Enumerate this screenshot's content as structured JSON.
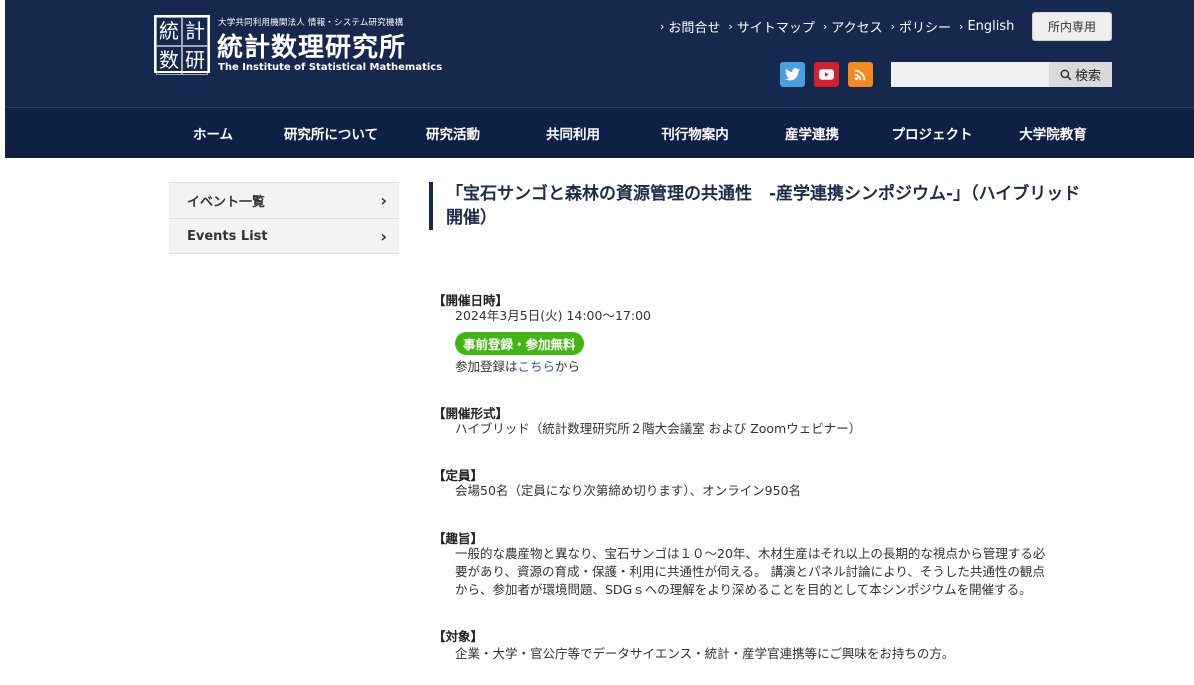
{
  "header": {
    "logo_mark": [
      "統",
      "計",
      "数",
      "研"
    ],
    "logo_sub": "大学共同利用機関法人 情報・システム研究機構",
    "logo_title": "統計数理研究所",
    "logo_en": "The Institute of Statistical Mathematics",
    "util_links": [
      {
        "label": "お問合せ"
      },
      {
        "label": "サイトマップ"
      },
      {
        "label": "アクセス"
      },
      {
        "label": "ポリシー"
      },
      {
        "label": "English"
      }
    ],
    "staff_button": "所内専用",
    "search": {
      "placeholder": "",
      "button_label": "検索"
    },
    "social_colors": {
      "twitter": "#4a9fe0",
      "youtube": "#d4202a",
      "rss": "#f28a1e"
    }
  },
  "nav": {
    "items": [
      {
        "label": "ホーム"
      },
      {
        "label": "研究所について"
      },
      {
        "label": "研究活動"
      },
      {
        "label": "共同利用"
      },
      {
        "label": "刊行物案内"
      },
      {
        "label": "産学連携"
      },
      {
        "label": "プロジェクト"
      },
      {
        "label": "大学院教育"
      }
    ]
  },
  "sidebar": {
    "items": [
      {
        "label": "イベント一覧"
      },
      {
        "label": "Events List"
      }
    ]
  },
  "main": {
    "title": "「宝石サンゴと森林の資源管理の共通性　-産学連携シンポジウム-」（ハイブリッド開催）",
    "date_head": "【開催日時】",
    "date_value": "2024年3月5日(火) 14:00～17:00",
    "badge": "事前登録・参加無料",
    "reg_prefix": "参加登録は",
    "reg_link": "こちら",
    "reg_suffix": "から",
    "format_head": "【開催形式】",
    "format_value": "ハイブリッド（統計数理研究所２階大会議室 および Zoomウェビナー）",
    "capacity_head": "【定員】",
    "capacity_value": "会場50名（定員になり次第締め切ります）、オンライン950名",
    "purpose_head": "【趣旨】",
    "purpose_lines": [
      "一般的な農産物と異なり、宝石サンゴは１０～20年、木材生産はそれ以上の長期的な視点から管理する必",
      "要があり、資源の育成・保護・利用に共通性が伺える。 講演とパネル討論により、そうした共通性の観点",
      "から、参加者が環境問題、SDGｓへの理解をより深めることを目的として本シンポジウムを開催する。"
    ],
    "target_head": "【対象】",
    "target_value": "企業・大学・官公庁等でデータサイエンス・統計・産学官連携等にご興味をお持ちの方。"
  }
}
